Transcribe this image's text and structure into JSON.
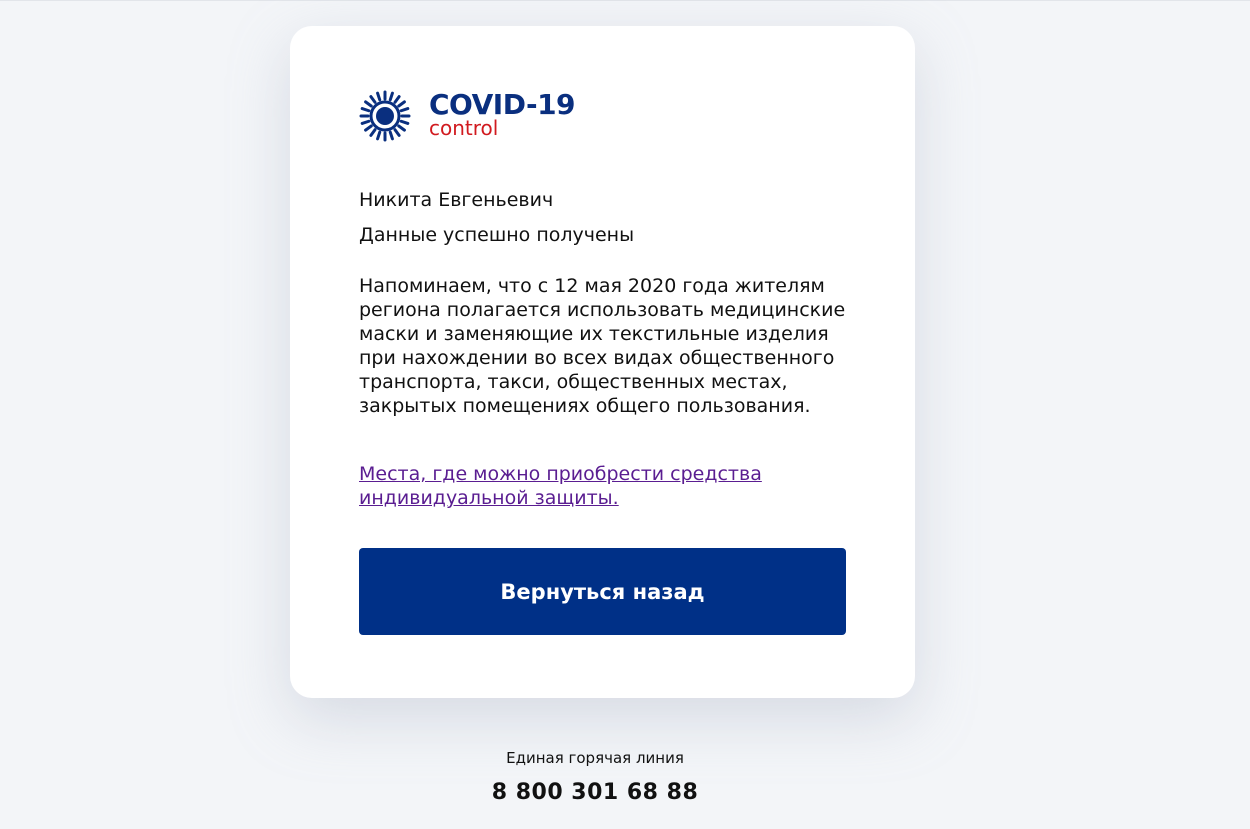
{
  "logo": {
    "title": "COVID-19",
    "subtitle": "control",
    "icon": "virus-icon",
    "colors": {
      "title": "#0a2f7f",
      "subtitle": "#d11a1f"
    }
  },
  "card": {
    "user_name": "Никита Евгеньевич",
    "status": "Данные успешно получены",
    "notice": "Напоминаем, что с 12 мая 2020 года жителям региона полагается использовать медицинские маски и заменяющие их текстильные изделия при нахождении во всех видах общественного транспорта, такси, общественных местах, закрытых помещениях общего пользования.",
    "link_text": "Места, где можно приобрести средства индивидуальной защиты.",
    "back_button_label": "Вернуться назад"
  },
  "footer": {
    "hotline_label": "Единая горячая линия",
    "hotline_phone": "8 800 301 68 88"
  },
  "colors": {
    "accent": "#003087",
    "link": "#5a1d91",
    "background": "#f3f5f8"
  }
}
